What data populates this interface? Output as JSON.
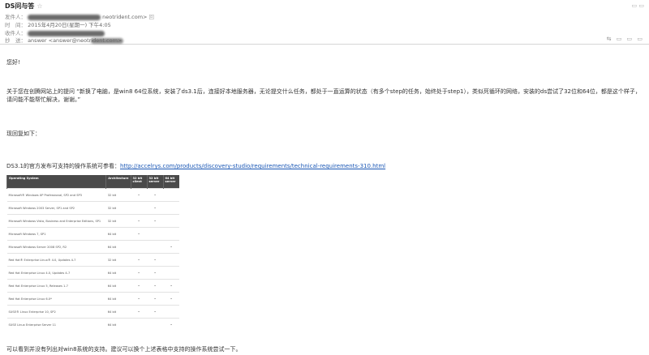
{
  "email": {
    "subject": "DS问与答",
    "star_icon": "star-icon",
    "from_label": "发件人：",
    "from_value": "neotrident.com>",
    "from_extra": "回",
    "time_label": "时　间：",
    "time_value": "2015年4月20日(星期一) 下午4:05",
    "to_label": "收件人：",
    "cc_label": "抄　送：",
    "cc_value": "answer <answer@neotrident.com>",
    "top_icons": "▭ ▭",
    "bottom_icons": "⇆ ▭ ▭ ▭"
  },
  "body": {
    "greeting": "您好!",
    "para1": "关于您在创腾网站上的提问 “新换了电脑，是win8 64位系统，安装了ds3.1后，连接好本地服务器，无论提交什么任务，都处于一直运算的状态（有多个step的任务，始终处于step1），类似死循环的网络，安装的ds尝试了32位和64位，都是这个样子，请问能不能帮忙解决，谢谢。”",
    "para2": "现回复如下：",
    "para3_prefix": "DS3.1的官方发布可支持的操作系统可参看：",
    "para3_link": "http://accelrys.com/products/discovery-studio/requirements/technical-requirements-310.html",
    "footer": "可以看到并没有列出对win8系统的支持。建议可以换个上述表格中支持的操作系统尝试一下。"
  },
  "table": {
    "headers": [
      "Operating System",
      "Architecture",
      "32 bit client",
      "32 bit server",
      "64 bit server"
    ],
    "rows": [
      {
        "os": "Microsoft® Windows XP Professional, SP2 and SP3",
        "arch": "32 bit",
        "c1": "•",
        "c2": "•",
        "c3": ""
      },
      {
        "os": "Microsoft Windows 2003 Server, SP1 and SP2",
        "arch": "32 bit",
        "c1": "",
        "c2": "•",
        "c3": ""
      },
      {
        "os": "Microsoft Windows Vista, Business and Enterprise Editions, SP1",
        "arch": "32 bit",
        "c1": "•",
        "c2": "•",
        "c3": ""
      },
      {
        "os": "Microsoft Windows 7, SP1",
        "arch": "64 bit",
        "c1": "•",
        "c2": "",
        "c3": ""
      },
      {
        "os": "Microsoft Windows Server 2008 SP2, R2",
        "arch": "64 bit",
        "c1": "",
        "c2": "",
        "c3": "•"
      },
      {
        "os": "Red Hat® Enterprise Linux® 4.0, Updates 4-7",
        "arch": "32 bit",
        "c1": "•",
        "c2": "•",
        "c3": ""
      },
      {
        "os": "Red Hat Enterprise Linux 4.0, Updates 4-7",
        "arch": "64 bit",
        "c1": "•",
        "c2": "•",
        "c3": ""
      },
      {
        "os": "Red Hat Enterprise Linux 5, Releases 1-7",
        "arch": "64 bit",
        "c1": "•",
        "c2": "•",
        "c3": "•"
      },
      {
        "os": "Red Hat Enterprise Linux 6.0*",
        "arch": "64 bit",
        "c1": "•",
        "c2": "•",
        "c3": "•"
      },
      {
        "os": "SUSE® Linux Enterprise 10, SP2",
        "arch": "64 bit",
        "c1": "•",
        "c2": "•",
        "c3": ""
      },
      {
        "os": "SUSE Linux Enterprise Server 11",
        "arch": "64 bit",
        "c1": "",
        "c2": "",
        "c3": "•"
      }
    ]
  }
}
